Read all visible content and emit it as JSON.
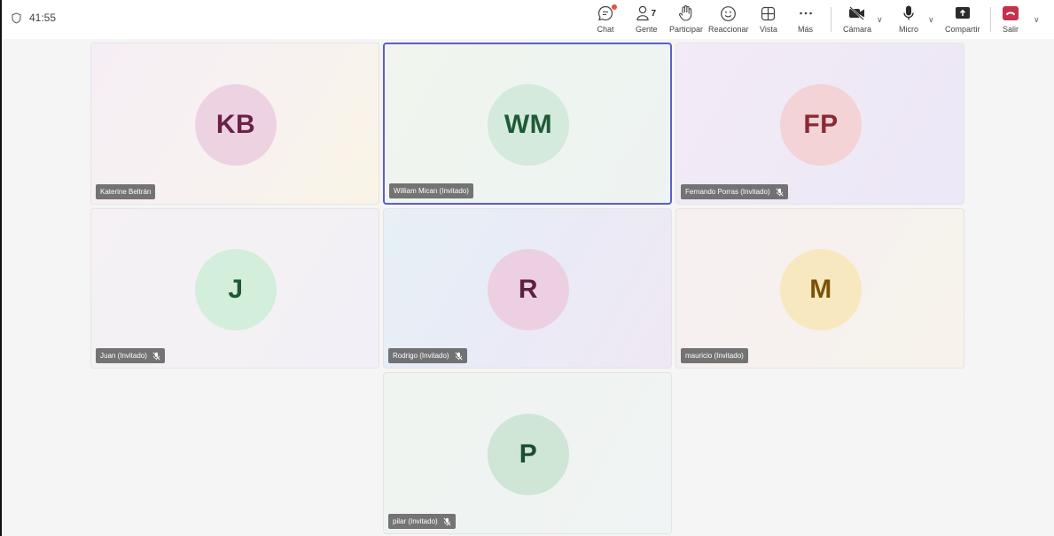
{
  "meeting": {
    "elapsed_time": "41:55"
  },
  "toolbar": {
    "chat_label": "Chat",
    "people_label": "Gente",
    "people_count": "7",
    "raise_label": "Participar",
    "react_label": "Reaccionar",
    "view_label": "Vista",
    "more_label": "Más",
    "camera_label": "Cámara",
    "mic_label": "Micro",
    "share_label": "Compartir",
    "leave_label": "Salir"
  },
  "colors": {
    "accent": "#5b5fc7",
    "leave": "#c4314b",
    "badge": "#e0533b"
  },
  "participants": [
    {
      "initials": "KB",
      "name": "Katerine Beltrán",
      "muted": false,
      "active": false,
      "avatar_bg": "#edd3e1",
      "avatar_fg": "#6b2148"
    },
    {
      "initials": "WM",
      "name": "William Mican (Invitado)",
      "muted": false,
      "active": true,
      "avatar_bg": "#d3eadd",
      "avatar_fg": "#1f5a36"
    },
    {
      "initials": "FP",
      "name": "Fernando Porras (Invitado)",
      "muted": true,
      "active": false,
      "avatar_bg": "#f3d3d6",
      "avatar_fg": "#8a2a35"
    },
    {
      "initials": "J",
      "name": "Juan (Invitado)",
      "muted": true,
      "active": false,
      "avatar_bg": "#d4eedc",
      "avatar_fg": "#1c5a34"
    },
    {
      "initials": "R",
      "name": "Rodrigo (Invitado)",
      "muted": true,
      "active": false,
      "avatar_bg": "#ecd0e1",
      "avatar_fg": "#5e2040"
    },
    {
      "initials": "M",
      "name": "mauricio (Invitado)",
      "muted": false,
      "active": false,
      "avatar_bg": "#f8e8c0",
      "avatar_fg": "#7a5206"
    },
    {
      "initials": "P",
      "name": "pilar (Invitado)",
      "muted": true,
      "active": false,
      "avatar_bg": "#cfe5d6",
      "avatar_fg": "#1b4d2f"
    }
  ]
}
